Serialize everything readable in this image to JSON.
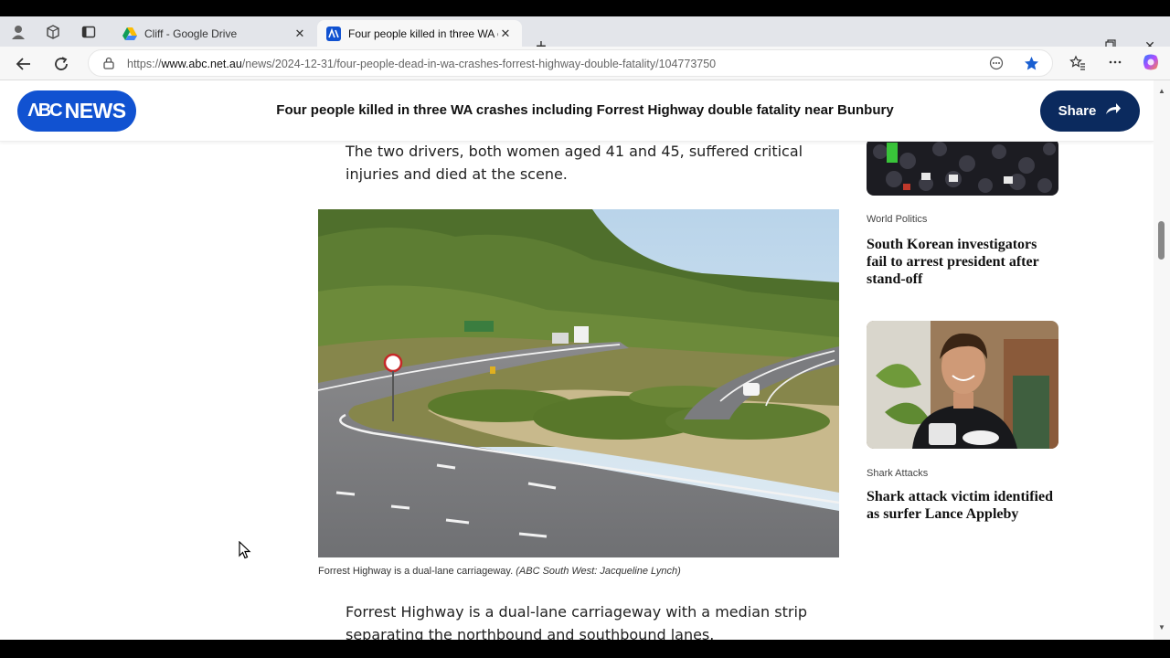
{
  "browser": {
    "tabs": [
      {
        "title": "Cliff - Google Drive",
        "active": false
      },
      {
        "title": "Four people killed in three WA crashes",
        "active": true
      }
    ],
    "url_prefix": "https://",
    "url_domain": "www.abc.net.au",
    "url_path": "/news/2024-12-31/four-people-dead-in-wa-crashes-forrest-highway-double-fatality/104773750"
  },
  "header": {
    "logo_mark": "ΛΒC",
    "logo_text": "NEWS",
    "headline": "Four people killed in three WA crashes including Forrest Highway double fatality near Bunbury",
    "share_label": "Share"
  },
  "article": {
    "para1": "The two drivers, both women aged 41 and 45, suffered critical injuries and died at the scene.",
    "caption": "Forrest Highway is a dual-lane carriageway.",
    "caption_credit": "(ABC South West: Jacqueline Lynch)",
    "para2": "Forrest Highway is a dual-lane carriageway with a median strip separating the northbound and southbound lanes."
  },
  "sidebar": {
    "items": [
      {
        "category": "World Politics",
        "headline": "South Korean investigators fail to arrest president after stand-off"
      },
      {
        "category": "Shark Attacks",
        "headline": "Shark attack victim identified as surfer Lance Appleby"
      }
    ]
  },
  "colors": {
    "abc_blue": "#1152d1",
    "share_navy": "#0b2a5e"
  }
}
